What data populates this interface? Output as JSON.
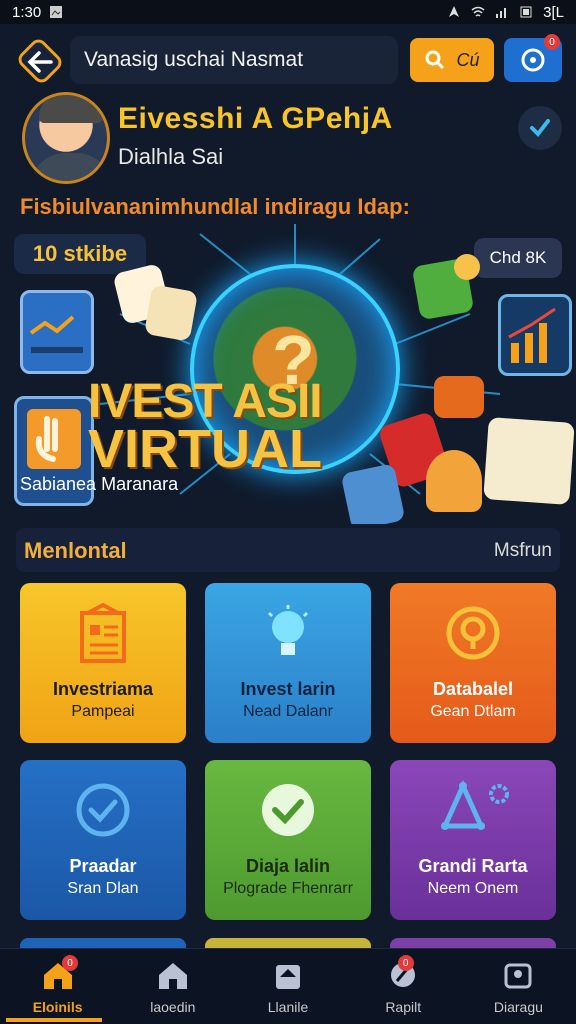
{
  "status_bar": {
    "time": "1:30",
    "battery": "3[L"
  },
  "top_bar": {
    "search_value": "Vanasig uschai Nasmat",
    "search_button_label": "Cú",
    "notification_badge": "0",
    "accent": "#f5a21a",
    "notif_color": "#1f6fd1"
  },
  "profile": {
    "name": "Eivesshi A GPehjA",
    "subtitle": "Dialhla Sai"
  },
  "headline": "Fisbiulvananimhundlal indiragu Idap:",
  "hero": {
    "pill_left": "10 stkibe",
    "pill_right": "Chd 8K",
    "title_line1": "IVEST ASII",
    "title_line2": "VIRTUAL",
    "caption": "Sabianea Maranara"
  },
  "section": {
    "title": "Menlontal",
    "link": "Msfrun"
  },
  "cards": [
    {
      "title": "Investriama",
      "subtitle": "Pampeai",
      "icon": "document-icon",
      "color": "#f2b21b"
    },
    {
      "title": "Invest larin",
      "subtitle": "Nead Dalanr",
      "icon": "lightbulb-icon",
      "color": "#2f8fd6"
    },
    {
      "title": "Databalel",
      "subtitle": "Gean Dtlam",
      "icon": "target-icon",
      "color": "#ea6a1f"
    },
    {
      "title": "Praadar",
      "subtitle": "Sran Dlan",
      "icon": "check-circle-icon",
      "color": "#1e63b8"
    },
    {
      "title": "Diaja lalin",
      "subtitle": "Plograde Fhenrarr",
      "icon": "check-circle-icon",
      "color": "#5aa83a"
    },
    {
      "title": "Grandi Rarta",
      "subtitle": "Neem Onem",
      "icon": "triangle-nodes-icon",
      "color": "#7d3fa8"
    }
  ],
  "bottom_nav": [
    {
      "label": "Eloinils",
      "icon": "home-icon",
      "active": true,
      "badge": "0"
    },
    {
      "label": "laoedin",
      "icon": "home-icon",
      "active": false
    },
    {
      "label": "Llanile",
      "icon": "briefcase-icon",
      "active": false
    },
    {
      "label": "Rapilt",
      "icon": "chat-icon",
      "active": false,
      "badge": "0"
    },
    {
      "label": "Diaragu",
      "icon": "user-icon",
      "active": false
    }
  ]
}
